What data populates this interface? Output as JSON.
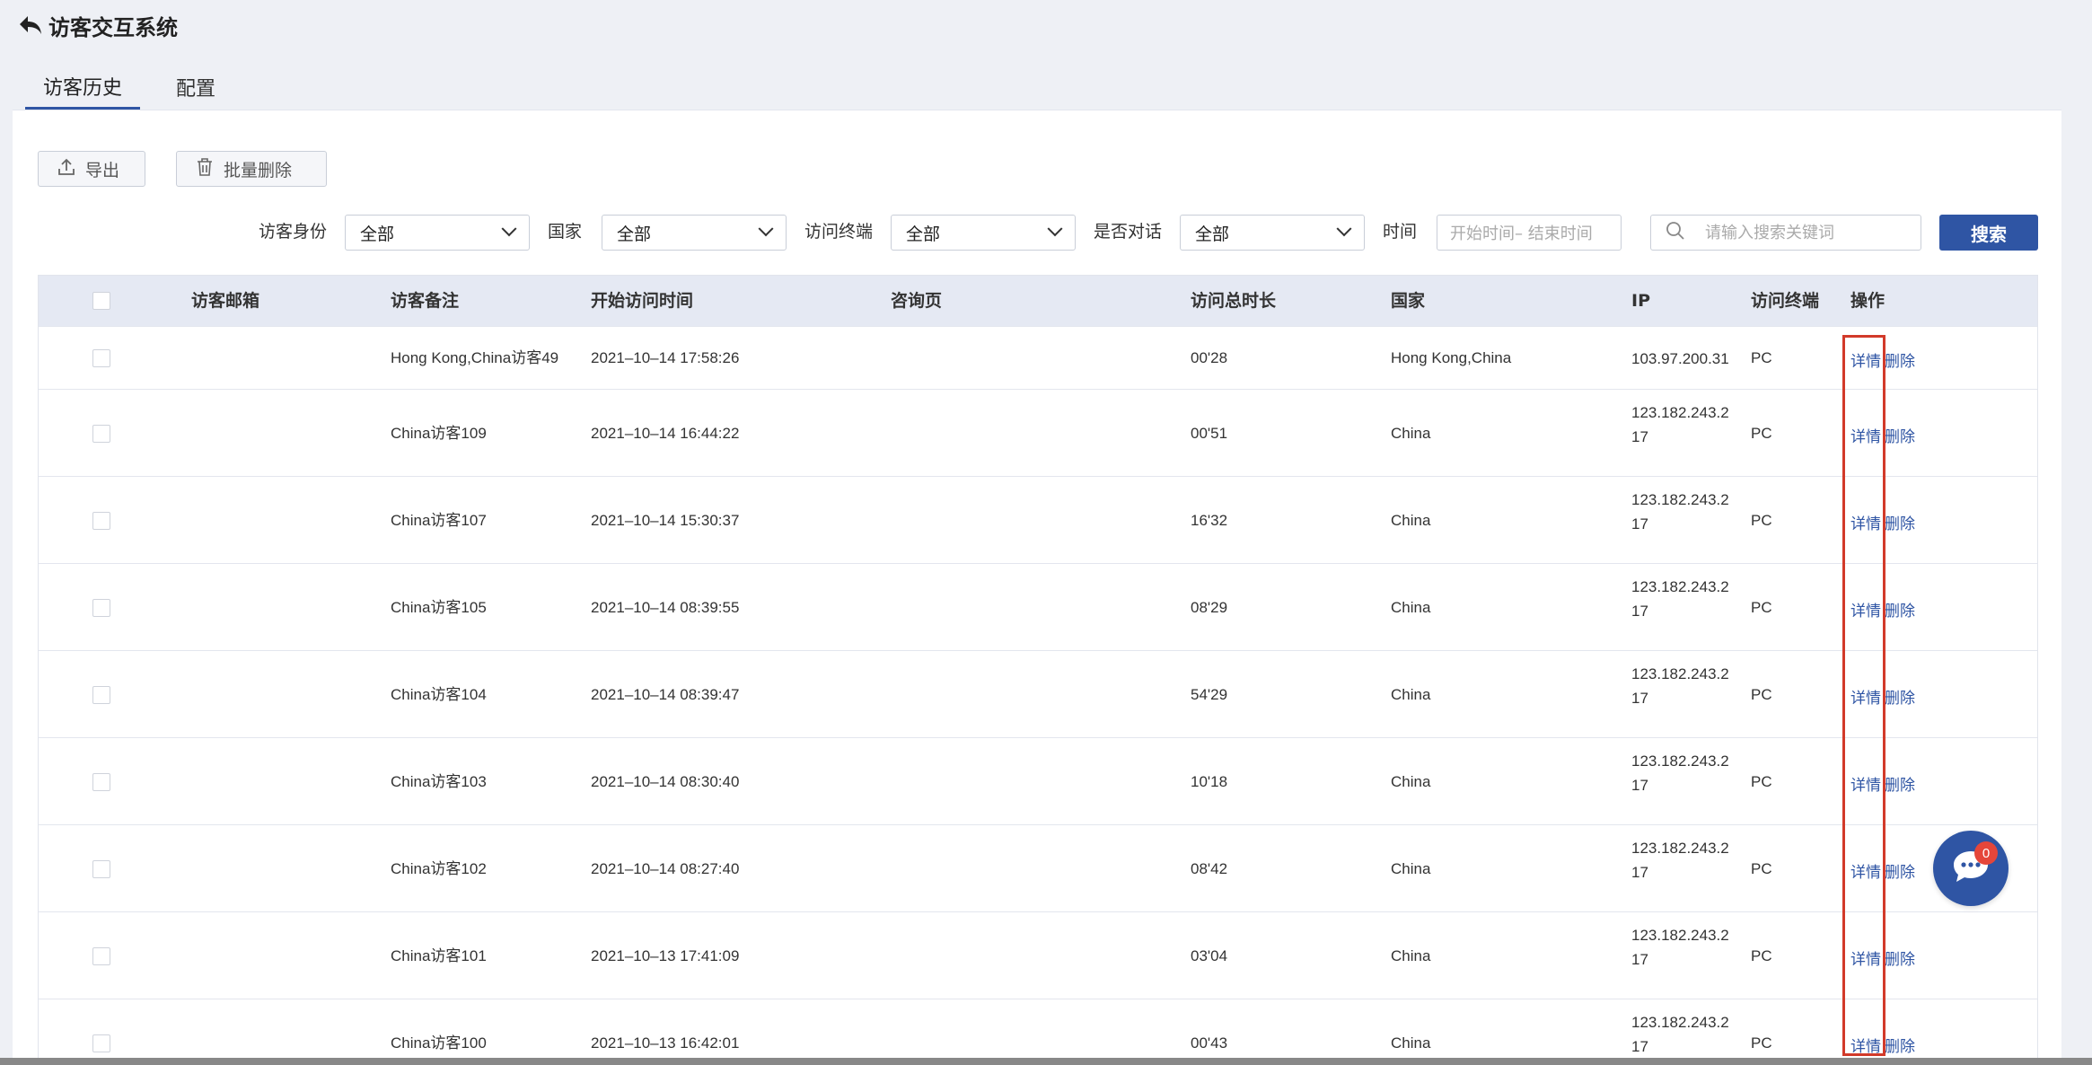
{
  "app": {
    "title": "访客交互系统"
  },
  "tabs": [
    {
      "label": "访客历史",
      "active": true
    },
    {
      "label": "配置",
      "active": false
    }
  ],
  "toolbar": {
    "export_label": "导出",
    "batch_delete_label": "批量删除"
  },
  "filters": {
    "identity": {
      "label": "访客身份",
      "value": "全部"
    },
    "country": {
      "label": "国家",
      "value": "全部"
    },
    "terminal": {
      "label": "访问终端",
      "value": "全部"
    },
    "dialog": {
      "label": "是否对话",
      "value": "全部"
    },
    "time": {
      "label": "时间",
      "placeholder": "开始时间– 结束时间"
    },
    "search": {
      "placeholder": "请输入搜索关键词",
      "button": "搜索"
    }
  },
  "table": {
    "headers": {
      "email": "访客邮箱",
      "note": "访客备注",
      "start_time": "开始访问时间",
      "page": "咨询页",
      "duration": "访问总时长",
      "country": "国家",
      "ip": "IP",
      "terminal": "访问终端",
      "actions": "操作"
    },
    "action_labels": {
      "detail": "详情",
      "delete": "删除"
    },
    "rows": [
      {
        "email": "",
        "note": "Hong Kong,China访客49",
        "start_time": "2021–10–14 17:58:26",
        "page": "",
        "duration": "00'28",
        "country": "Hong Kong,China",
        "ip_line1": "103.97.200.31",
        "ip_line2": "",
        "terminal": "PC"
      },
      {
        "email": "",
        "note": "China访客109",
        "start_time": "2021–10–14 16:44:22",
        "page": "",
        "duration": "00'51",
        "country": "China",
        "ip_line1": "123.182.243.2",
        "ip_line2": "17",
        "terminal": "PC"
      },
      {
        "email": "",
        "note": "China访客107",
        "start_time": "2021–10–14 15:30:37",
        "page": "",
        "duration": "16'32",
        "country": "China",
        "ip_line1": "123.182.243.2",
        "ip_line2": "17",
        "terminal": "PC"
      },
      {
        "email": "",
        "note": "China访客105",
        "start_time": "2021–10–14 08:39:55",
        "page": "",
        "duration": "08'29",
        "country": "China",
        "ip_line1": "123.182.243.2",
        "ip_line2": "17",
        "terminal": "PC"
      },
      {
        "email": "",
        "note": "China访客104",
        "start_time": "2021–10–14 08:39:47",
        "page": "",
        "duration": "54'29",
        "country": "China",
        "ip_line1": "123.182.243.2",
        "ip_line2": "17",
        "terminal": "PC"
      },
      {
        "email": "",
        "note": "China访客103",
        "start_time": "2021–10–14 08:30:40",
        "page": "",
        "duration": "10'18",
        "country": "China",
        "ip_line1": "123.182.243.2",
        "ip_line2": "17",
        "terminal": "PC"
      },
      {
        "email": "",
        "note": "China访客102",
        "start_time": "2021–10–14 08:27:40",
        "page": "",
        "duration": "08'42",
        "country": "China",
        "ip_line1": "123.182.243.2",
        "ip_line2": "17",
        "terminal": "PC"
      },
      {
        "email": "",
        "note": "China访客101",
        "start_time": "2021–10–13 17:41:09",
        "page": "",
        "duration": "03'04",
        "country": "China",
        "ip_line1": "123.182.243.2",
        "ip_line2": "17",
        "terminal": "PC"
      },
      {
        "email": "",
        "note": "China访客100",
        "start_time": "2021–10–13 16:42:01",
        "page": "",
        "duration": "00'43",
        "country": "China",
        "ip_line1": "123.182.243.2",
        "ip_line2": "17",
        "terminal": "PC"
      }
    ]
  },
  "chat": {
    "badge_count": "0"
  },
  "colors": {
    "primary": "#2f55a4",
    "highlight": "#d23a2a",
    "badge": "#e5463a"
  }
}
